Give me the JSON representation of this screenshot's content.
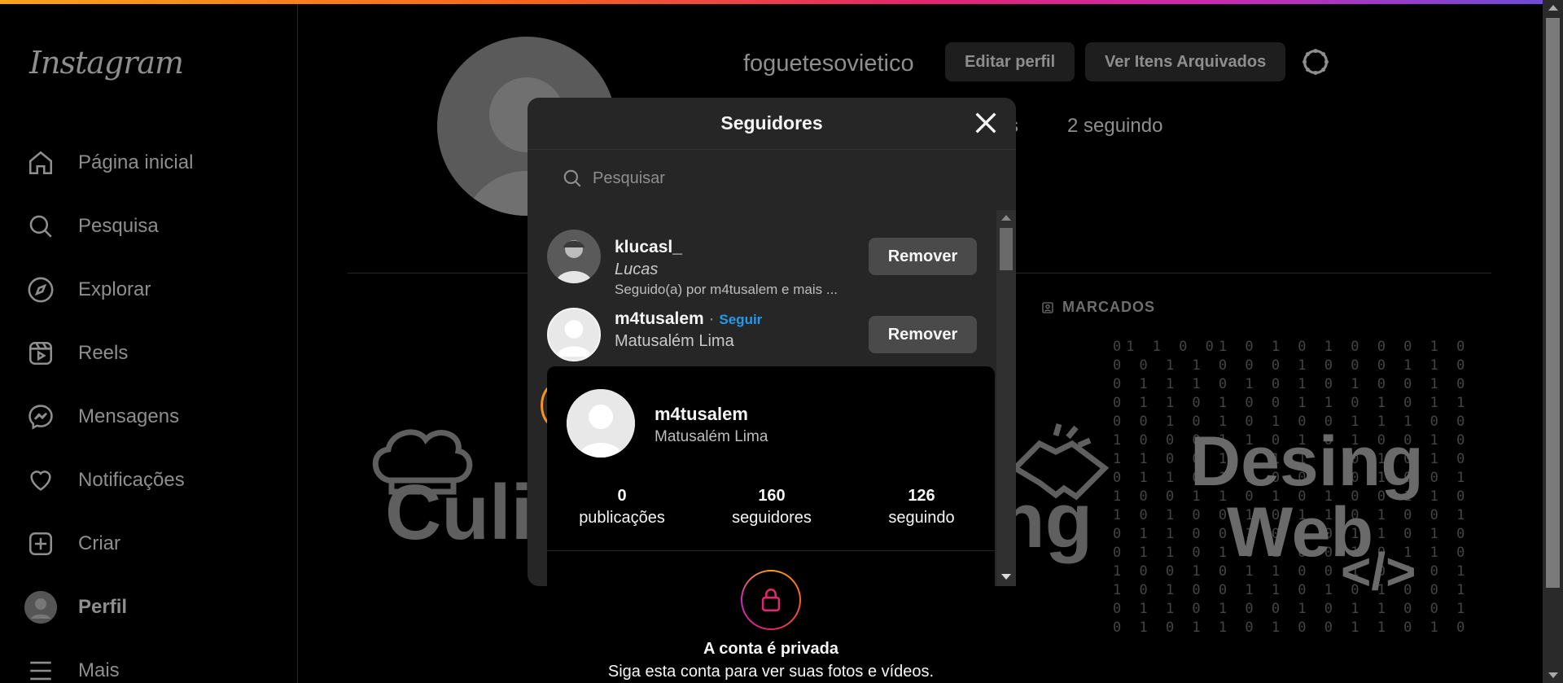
{
  "colors": {
    "accent_link": "#1e9bf0",
    "gradient": [
      "#f9a21b",
      "#f7641b",
      "#e2256f",
      "#c92bb7",
      "#6d4bd8"
    ]
  },
  "sidebar": {
    "logo": "Instagram",
    "items": [
      {
        "label": "Página inicial",
        "icon": "home-icon"
      },
      {
        "label": "Pesquisa",
        "icon": "search-icon"
      },
      {
        "label": "Explorar",
        "icon": "compass-icon"
      },
      {
        "label": "Reels",
        "icon": "reels-icon"
      },
      {
        "label": "Mensagens",
        "icon": "messenger-icon"
      },
      {
        "label": "Notificações",
        "icon": "heart-icon"
      },
      {
        "label": "Criar",
        "icon": "plus-square-icon"
      },
      {
        "label": "Perfil",
        "icon": "avatar"
      },
      {
        "label": "Mais",
        "icon": "menu-icon"
      }
    ]
  },
  "profile": {
    "username": "foguetesovietico",
    "edit_label": "Editar perfil",
    "archive_label": "Ver Itens Arquivados",
    "followers_partial": "s",
    "following_label": "2 seguindo",
    "tab_tagged": "MARCADOS",
    "posts": {
      "p1": "Culin",
      "p2": "ng",
      "p3_line1": "Desing",
      "p3_line2": "Web",
      "p3_code": "</>"
    }
  },
  "modal": {
    "title": "Seguidores",
    "search_placeholder": "Pesquisar",
    "followers": [
      {
        "handle": "klucasl_",
        "fullname": "Lucas",
        "meta": "Seguido(a) por m4tusalem e mais ...",
        "action": "Remover"
      },
      {
        "handle": "m4tusalem",
        "separator": " · ",
        "follow": "Seguir",
        "fullname": "Matusalém Lima",
        "action": "Remover"
      }
    ]
  },
  "hovercard": {
    "handle": "m4tusalem",
    "fullname": "Matusalém Lima",
    "stats": [
      {
        "n": "0",
        "l": "publicações"
      },
      {
        "n": "160",
        "l": "seguidores"
      },
      {
        "n": "126",
        "l": "seguindo"
      }
    ],
    "private_title": "A conta é privada",
    "private_sub": "Siga esta conta para ver suas fotos e vídeos."
  },
  "code_rain": "01 1 0 01 0 1 0 1 0 0 0 1 0 0 0 1 1 0 0 0 1 0 0 0 1 1 0 0 1 1 1 0 1 0 1 0 1 0 0 1 0 0 1 1 0 1 0 0 1 1 0 1 0 1 1 0 0 1 0 1 0 1 0 0 1 1 1 0 0 1 0 0 0 1 1 0 1 0 1 0 0 1 0 1 1 0 0 1 0 1 1 0 0 1 0 1 0 0 1 1 0 1 1 0 0 1 0 1 0 0 1 1 0 0 1 1 0 1 0 1 0 0 1 1 0 1 0 1 0 0 1 0 1 1 0 1 0 0 1 0 1 1 0 0 1 0 1 0 1 1 0 1 0 0 1 1 0 1 0 1 0 0 1 0 1 1 0 1 0 0 1 0 1 1 0 0 1 0 1 0 1 1 0 1 0 0 1 1 0 1 0 1 0 0 1 0 1 1 0 1 0 0 1 0 1 1 0 0 1 0 1 0 1 1 0 1 0 0 1 1 0 1 0"
}
